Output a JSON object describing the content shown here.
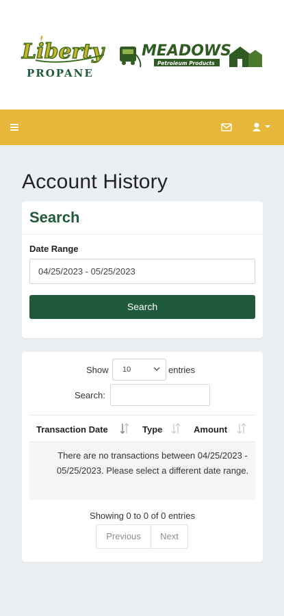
{
  "brand": {
    "liberty_name": "Liberty",
    "liberty_sub": "PROPANE",
    "meadows_name": "MEADOWS",
    "meadows_sub": "Petroleum Products"
  },
  "colors": {
    "navbar": "#e6b73a",
    "primary": "#1f5a3c",
    "page_bg": "#ebeef2"
  },
  "navbar": {
    "menu_icon": "hamburger-icon",
    "mail_icon": "envelope-icon",
    "user_icon": "user-icon",
    "caret_icon": "caret-down-icon"
  },
  "page": {
    "title": "Account History"
  },
  "search_card": {
    "title": "Search",
    "date_range_label": "Date Range",
    "date_range_value": "04/25/2023 - 05/25/2023",
    "button_label": "Search"
  },
  "table_card": {
    "show_label": "Show",
    "page_length": "10",
    "entries_label": "entries",
    "filter_label": "Search:",
    "filter_value": "",
    "columns": [
      "Transaction Date",
      "Type",
      "Amount"
    ],
    "empty_message": "There are no transactions between 04/25/2023 - 05/25/2023. Please select a different date range.",
    "info": "Showing 0 to 0 of 0 entries",
    "previous_label": "Previous",
    "next_label": "Next"
  }
}
